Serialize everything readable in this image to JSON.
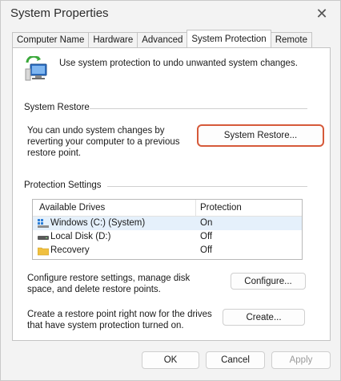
{
  "window": {
    "title": "System Properties"
  },
  "tabs": [
    {
      "label": "Computer Name",
      "active": false
    },
    {
      "label": "Hardware",
      "active": false
    },
    {
      "label": "Advanced",
      "active": false
    },
    {
      "label": "System Protection",
      "active": true
    },
    {
      "label": "Remote",
      "active": false
    }
  ],
  "intro": {
    "text": "Use system protection to undo unwanted system changes."
  },
  "system_restore": {
    "group_label": "System Restore",
    "description": "You can undo system changes by reverting your computer to a previous restore point.",
    "button_label": "System Restore..."
  },
  "protection_settings": {
    "group_label": "Protection Settings",
    "columns": [
      "Available Drives",
      "Protection"
    ],
    "drives": [
      {
        "name": "Windows (C:) (System)",
        "protection": "On",
        "icon": "windows-drive-icon"
      },
      {
        "name": "Local Disk (D:)",
        "protection": "Off",
        "icon": "disk-drive-icon"
      },
      {
        "name": "Recovery",
        "protection": "Off",
        "icon": "folder-icon"
      }
    ],
    "configure_text": "Configure restore settings, manage disk space, and delete restore points.",
    "configure_label": "Configure...",
    "create_text": "Create a restore point right now for the drives that have system protection turned on.",
    "create_label": "Create..."
  },
  "footer": {
    "ok_label": "OK",
    "cancel_label": "Cancel",
    "apply_label": "Apply"
  },
  "colors": {
    "highlight_border": "#d65a3a",
    "selected_row": "#e5f0fb"
  }
}
